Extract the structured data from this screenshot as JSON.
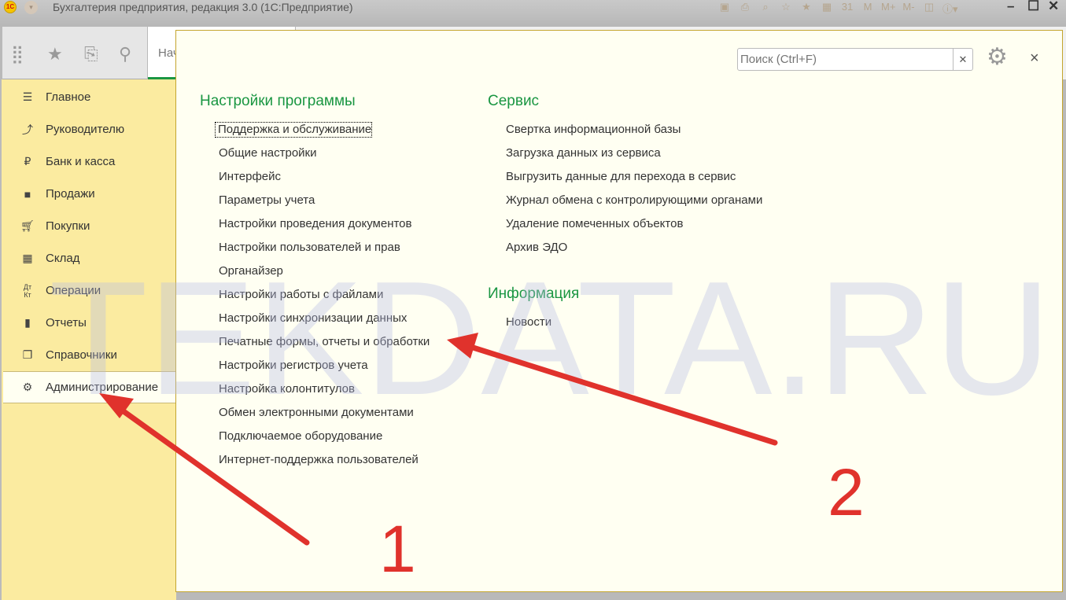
{
  "window": {
    "title": "Бухгалтерия предприятия, редакция 3.0  (1С:Предприятие)",
    "logo": "1С"
  },
  "toolbar_icons": [
    "save-icon",
    "print-icon",
    "preview-icon",
    "add-favorite-icon",
    "favorites-icon",
    "calculator-icon",
    "calendar-icon",
    "M",
    "M+",
    "M-",
    "split-view-icon",
    "info-icon"
  ],
  "tab": {
    "label": "Нач"
  },
  "sidebar": {
    "items": [
      {
        "label": "Главное",
        "icon": "menu-icon"
      },
      {
        "label": "Руководителю",
        "icon": "trend-icon"
      },
      {
        "label": "Банк и касса",
        "icon": "ruble-icon"
      },
      {
        "label": "Продажи",
        "icon": "bag-icon"
      },
      {
        "label": "Покупки",
        "icon": "cart-icon"
      },
      {
        "label": "Склад",
        "icon": "warehouse-icon"
      },
      {
        "label": "Операции",
        "icon": "dt-kt-icon"
      },
      {
        "label": "Отчеты",
        "icon": "chart-icon"
      },
      {
        "label": "Справочники",
        "icon": "books-icon"
      },
      {
        "label": "Администрирование",
        "icon": "gear-icon"
      }
    ]
  },
  "panel": {
    "search_placeholder": "Поиск (Ctrl+F)",
    "sections": [
      {
        "title": "Настройки программы",
        "items": [
          "Поддержка и обслуживание",
          "Общие настройки",
          "Интерфейс",
          "Параметры учета",
          "Настройки проведения документов",
          "Настройки пользователей и прав",
          "Органайзер",
          "Настройки работы с файлами",
          "Настройки синхронизации данных",
          "Печатные формы, отчеты и обработки",
          "Настройки регистров учета",
          "Настройка колонтитулов",
          "Обмен электронными документами",
          "Подключаемое оборудование",
          "Интернет-поддержка пользователей"
        ]
      },
      {
        "title": "Сервис",
        "items": [
          "Свертка информационной базы",
          "Загрузка данных из сервиса",
          "Выгрузить данные для перехода в сервис",
          "Журнал обмена с контролирующими органами",
          "Удаление помеченных объектов",
          "Архив ЭДО"
        ]
      },
      {
        "title": "Информация",
        "items": [
          "Новости"
        ]
      }
    ]
  },
  "watermark": "TEKDATA.RU",
  "annotations": {
    "step1": "1",
    "step2": "2",
    "color": "#e0322c"
  }
}
